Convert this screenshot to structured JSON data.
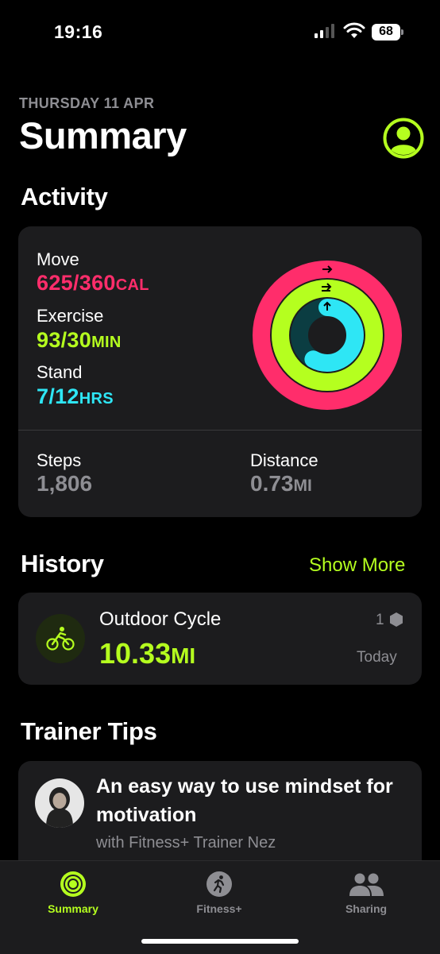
{
  "status_bar": {
    "time": "19:16",
    "battery": "68"
  },
  "header": {
    "date": "THURSDAY 11 APR",
    "title": "Summary"
  },
  "activity": {
    "heading": "Activity",
    "move": {
      "label": "Move",
      "value": "625/360",
      "unit": "CAL"
    },
    "exercise": {
      "label": "Exercise",
      "value": "93/30",
      "unit": "MIN"
    },
    "stand": {
      "label": "Stand",
      "value": "7/12",
      "unit": "HRS"
    },
    "steps": {
      "label": "Steps",
      "value": "1,806"
    },
    "distance": {
      "label": "Distance",
      "value": "0.73",
      "unit": "MI"
    },
    "rings": {
      "move_fraction": 1.736,
      "exercise_fraction": 3.1,
      "stand_fraction": 0.583
    },
    "colors": {
      "move": "#ff2d6b",
      "exercise": "#b5ff1f",
      "stand": "#2ee6f5"
    }
  },
  "history": {
    "heading": "History",
    "show_more": "Show More",
    "item": {
      "title": "Outdoor Cycle",
      "value": "10.33",
      "unit": "MI",
      "count": "1",
      "when": "Today"
    }
  },
  "trainer_tips": {
    "heading": "Trainer Tips",
    "title": "An easy way to use mindset for motivation",
    "subtitle": "with Fitness+ Trainer Nez"
  },
  "tabs": [
    {
      "label": "Summary",
      "icon": "activity-rings-icon",
      "active": true
    },
    {
      "label": "Fitness+",
      "icon": "runner-icon",
      "active": false
    },
    {
      "label": "Sharing",
      "icon": "people-icon",
      "active": false
    }
  ]
}
